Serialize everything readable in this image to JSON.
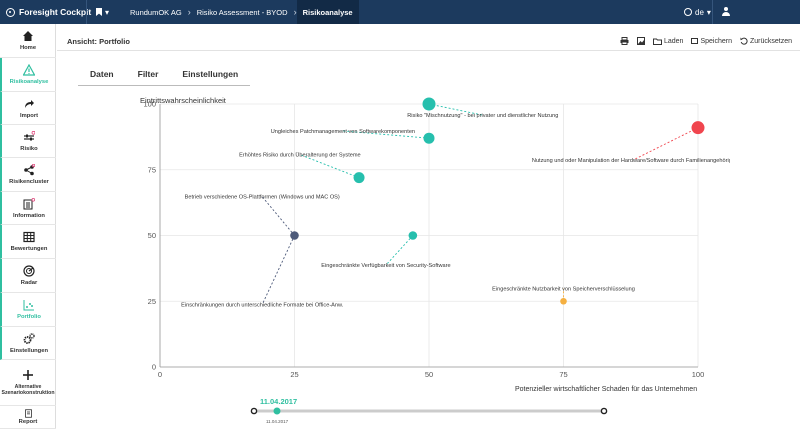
{
  "topbar": {
    "brand": "Foresight Cockpit",
    "bookmark_caret": "▾",
    "breadcrumbs": [
      "RundumOK AG",
      "Risiko Assessment - BYOD",
      "Risikoanalyse"
    ],
    "language": "de",
    "language_caret": "▾"
  },
  "sidebar": {
    "items": [
      {
        "label": "Home",
        "icon": "home-icon"
      },
      {
        "label": "Risikoanalyse",
        "icon": "warning-icon"
      },
      {
        "label": "Import",
        "icon": "import-arrow-icon"
      },
      {
        "label": "Risiko",
        "icon": "risk-sliders-icon"
      },
      {
        "label": "Risikencluster",
        "icon": "cluster-icon"
      },
      {
        "label": "Information",
        "icon": "information-list-icon"
      },
      {
        "label": "Bewertungen",
        "icon": "table-grid-icon"
      },
      {
        "label": "Radar",
        "icon": "radar-icon"
      },
      {
        "label": "Portfolio",
        "icon": "scatter-icon"
      },
      {
        "label": "Einstellungen",
        "icon": "gears-icon"
      },
      {
        "label": "Alternative Szenariokonstruktion",
        "icon": "plus-icon"
      },
      {
        "label": "Report",
        "icon": "report-icon"
      }
    ]
  },
  "header": {
    "title": "Ansicht: Portfolio",
    "load_label": "Laden",
    "save_label": "Speichern",
    "reset_label": "Zurücksetzen"
  },
  "tabs": [
    "Daten",
    "Filter",
    "Einstellungen"
  ],
  "timeline": {
    "current_label": "11.04.2017",
    "tick_label": "11.04.2017",
    "accent": "#2fbfa0"
  },
  "chart_data": {
    "type": "scatter",
    "ylabel": "Eintrittswahrscheinlichkeit",
    "xlabel": "Potenzieller wirtschaftlicher Schaden für das Unternehmen",
    "xlim": [
      0,
      100
    ],
    "ylim": [
      0,
      100
    ],
    "xticks": [
      0,
      25,
      50,
      75,
      100
    ],
    "yticks": [
      0,
      25,
      50,
      75,
      100
    ],
    "grid": true,
    "points": [
      {
        "x": 50,
        "y": 100,
        "label": "Risiko \"Mischnutzung\" - bei privater und dienstlicher Nutzung",
        "lx": 60,
        "ly": 95,
        "color": "#26bfad",
        "size": "large"
      },
      {
        "x": 100,
        "y": 91,
        "label": "Nutzung und oder Manipulation der Hardware/Software durch Familienangehörige",
        "lx": 88,
        "ly": 78,
        "color": "#f0454e",
        "size": "large"
      },
      {
        "x": 50,
        "y": 87,
        "label": "Ungleiches Patchmanagement von Softwarekomponenten",
        "lx": 34,
        "ly": 89,
        "color": "#26bfad",
        "size": "medium"
      },
      {
        "x": 37,
        "y": 72,
        "label": "Erhöhtes Risiko durch Überalterung der Systeme",
        "lx": 26,
        "ly": 80,
        "color": "#26bfad",
        "size": "medium"
      },
      {
        "x": 25,
        "y": 50,
        "label": "Betrieb verschiedene OS-Plattformen (Windows und MAC OS)",
        "lx": 19,
        "ly": 64,
        "color": "#4d5a7a",
        "size": "small"
      },
      {
        "x": 47,
        "y": 50,
        "label": "Eingeschränkte Verfügbarkeit von Security-Software",
        "lx": 42,
        "ly": 38,
        "color": "#26bfad",
        "size": "small"
      },
      {
        "x": 75,
        "y": 25,
        "label": "Eingeschränkte Nutzbarkeit von Speicherverschlüsselung",
        "lx": 75,
        "ly": 29,
        "color": "#f5b041",
        "size": "tiny"
      },
      {
        "x": 25,
        "y": 50,
        "label": "Einschränkungen durch unterschiedliche Formate bei Office-Anw.",
        "lx": 19,
        "ly": 23,
        "color": "#4d5a7a",
        "size": "none"
      }
    ]
  }
}
